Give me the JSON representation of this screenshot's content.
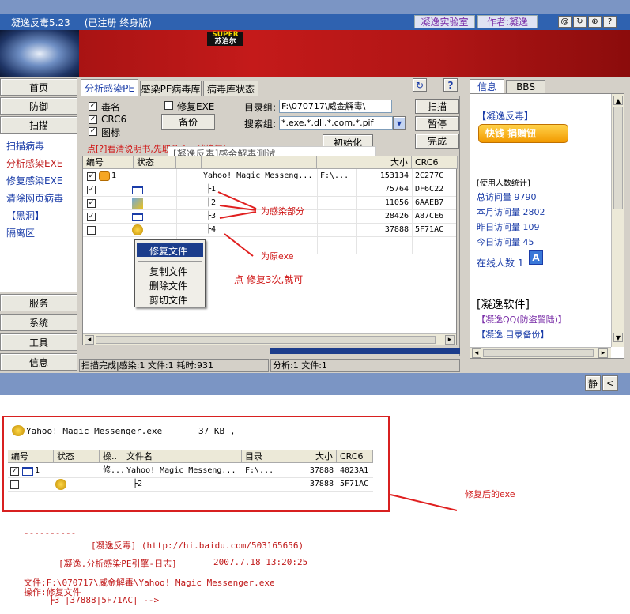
{
  "title_bar": {
    "app_name": "凝逸反毒5.23",
    "registration": "(已注册 终身版)",
    "lab_button": "凝逸实验室",
    "author_button": "作者:凝逸",
    "window_buttons": [
      "@",
      "↻",
      "⊕",
      "?"
    ]
  },
  "banner": {
    "ad_line1": "SUPER",
    "ad_line2": "苏泊尔"
  },
  "sidebar": {
    "top_buttons": [
      "首页",
      "防御",
      "扫描"
    ],
    "items": [
      "扫描病毒",
      "分析感染EXE",
      "修复感染EXE",
      "清除网页病毒",
      "【黑洞】",
      "隔离区"
    ],
    "bottom_buttons": [
      "服务",
      "系统",
      "工具",
      "信息"
    ]
  },
  "tabs": [
    "分析感染PE",
    "感染PE病毒库",
    "病毒库状态"
  ],
  "options": {
    "virus_name": "毒名",
    "crc6": "CRC6",
    "icon": "图标",
    "repair_exe": "修复EXE",
    "backup": "备份"
  },
  "fields": {
    "dir_label": "目录组:",
    "dir_value": "F:\\070717\\威金解毒\\",
    "search_label": "搜索组:",
    "search_value": "*.exe,*.dll,*.com,*.pif"
  },
  "buttons": {
    "scan": "扫描",
    "pause": "暂停",
    "init": "初始化",
    "done": "完成"
  },
  "notice": "点[?]看清说明书,先取几个一试修复!",
  "overlay_label": "[凝逸反毒]感金解毒测试",
  "grid": {
    "headers": [
      "编号",
      "状态",
      "",
      "",
      "",
      "",
      "大小",
      "CRC6"
    ],
    "rows": [
      {
        "num": "1",
        "name": "Yahoo! Magic Messeng...",
        "dir": "F:\\...",
        "size": "153134",
        "crc": "2C277C",
        "checked": true
      },
      {
        "num": "",
        "name": "├1",
        "dir": "",
        "size": "75764",
        "crc": "DF6C22",
        "checked": true
      },
      {
        "num": "",
        "name": "├2",
        "dir": "",
        "size": "11056",
        "crc": "6AAEB7",
        "checked": true
      },
      {
        "num": "",
        "name": "├3",
        "dir": "",
        "size": "28426",
        "crc": "A87CE6",
        "checked": true
      },
      {
        "num": "",
        "name": "├4",
        "dir": "",
        "size": "37888",
        "crc": "5F71AC",
        "checked": false
      }
    ]
  },
  "context_menu": [
    "修复文件",
    "复制文件",
    "删除文件",
    "剪切文件"
  ],
  "annotations": {
    "infected": "为感染部分",
    "original": "为原exe",
    "repair_tip": "点 修复3次,就可",
    "repaired": "修复后的exe"
  },
  "status": {
    "left": "扫描完成|感染:1 文件:1|耗时:931",
    "right": "分析:1 文件:1"
  },
  "right_tabs": [
    "信息",
    "BBS"
  ],
  "right_panel": {
    "title": "【凝逸反毒】",
    "donate": "快钱 捐赠钮",
    "stats_title": "[使用人数统计]",
    "stats": [
      {
        "label": "总访问量",
        "value": "9790"
      },
      {
        "label": "本月访问量",
        "value": "2802"
      },
      {
        "label": "昨日访问量",
        "value": "109"
      },
      {
        "label": "今日访问量",
        "value": "45"
      }
    ],
    "online_label": "在线人数",
    "online_value": "1",
    "software_head": "[凝逸软件]",
    "software_items": [
      "【凝逸QQ(防盗警陆)】",
      "【凝逸.目录备份】"
    ]
  },
  "bottom_strip": {
    "btn1": "静",
    "btn2": "<"
  },
  "repaired_box": {
    "title": "Yahoo! Magic Messenger.exe",
    "size": "37 KB",
    "dot": ",",
    "headers": [
      "编号",
      "状态",
      "操..",
      "文件名",
      "目录",
      "大小",
      "CRC6"
    ],
    "rows": [
      {
        "num": "1",
        "op": "修...",
        "name": "Yahoo! Magic Messeng...",
        "dir": "F:\\...",
        "size": "37888",
        "crc": "4023A1"
      },
      {
        "num": "",
        "op": "",
        "name": "├2",
        "dir": "",
        "size": "37888",
        "crc": "5F71AC"
      }
    ]
  },
  "log": {
    "dashes": "----------",
    "line1": "[凝逸反毒] (http://hi.baidu.com/503165656)",
    "line2a": "[凝逸.分析感染PE引擎-日志]",
    "line2b": "2007.7.18 13:20:25",
    "line3": "文件:F:\\070717\\威金解毒\\Yahoo! Magic Messenger.exe",
    "line4": "操作:修复文件",
    "line5": "├3 |37888|5F71AC| -->"
  }
}
